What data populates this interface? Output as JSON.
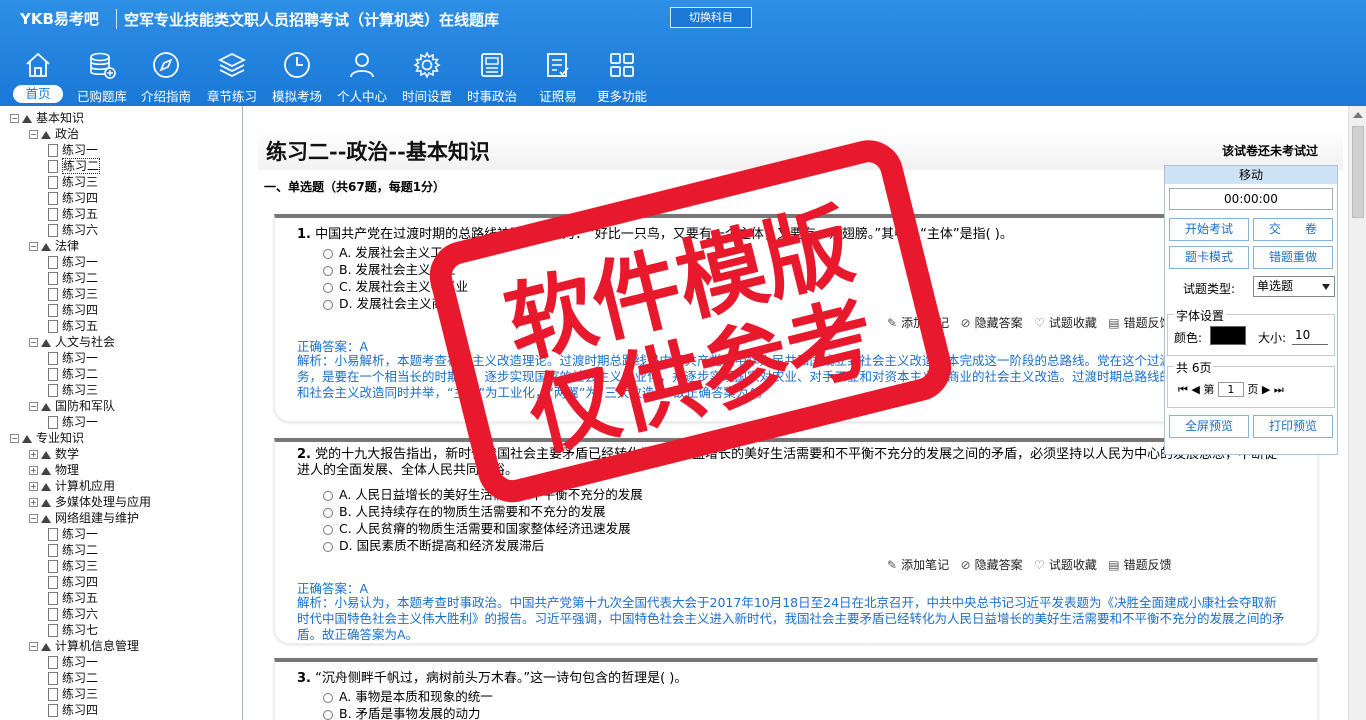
{
  "app": {
    "logo": "YKB易考吧",
    "title": "空军专业技能类文职人员招聘考试（计算机类）在线题库",
    "switch_subject": "切换科目"
  },
  "nav": [
    {
      "label": "首页",
      "icon": "home-icon",
      "active": true
    },
    {
      "label": "已购题库",
      "icon": "database-icon"
    },
    {
      "label": "介绍指南",
      "icon": "compass-icon"
    },
    {
      "label": "章节练习",
      "icon": "layers-icon"
    },
    {
      "label": "模拟考场",
      "icon": "clock-icon"
    },
    {
      "label": "个人中心",
      "icon": "user-icon"
    },
    {
      "label": "时间设置",
      "icon": "gear-icon"
    },
    {
      "label": "时事政治",
      "icon": "newspaper-icon"
    },
    {
      "label": "证照易",
      "icon": "checklist-icon"
    },
    {
      "label": "更多功能",
      "icon": "grid-icon"
    }
  ],
  "tree": [
    {
      "level": 0,
      "kind": "folder",
      "exp": "-",
      "label": "基本知识"
    },
    {
      "level": 1,
      "kind": "folder",
      "exp": "-",
      "label": "政治"
    },
    {
      "level": 2,
      "kind": "doc",
      "label": "练习一"
    },
    {
      "level": 2,
      "kind": "doc",
      "label": "练习二",
      "selected": true
    },
    {
      "level": 2,
      "kind": "doc",
      "label": "练习三"
    },
    {
      "level": 2,
      "kind": "doc",
      "label": "练习四"
    },
    {
      "level": 2,
      "kind": "doc",
      "label": "练习五"
    },
    {
      "level": 2,
      "kind": "doc",
      "label": "练习六"
    },
    {
      "level": 1,
      "kind": "folder",
      "exp": "-",
      "label": "法律"
    },
    {
      "level": 2,
      "kind": "doc",
      "label": "练习一"
    },
    {
      "level": 2,
      "kind": "doc",
      "label": "练习二"
    },
    {
      "level": 2,
      "kind": "doc",
      "label": "练习三"
    },
    {
      "level": 2,
      "kind": "doc",
      "label": "练习四"
    },
    {
      "level": 2,
      "kind": "doc",
      "label": "练习五"
    },
    {
      "level": 1,
      "kind": "folder",
      "exp": "-",
      "label": "人文与社会"
    },
    {
      "level": 2,
      "kind": "doc",
      "label": "练习一"
    },
    {
      "level": 2,
      "kind": "doc",
      "label": "练习二"
    },
    {
      "level": 2,
      "kind": "doc",
      "label": "练习三"
    },
    {
      "level": 1,
      "kind": "folder",
      "exp": "-",
      "label": "国防和军队"
    },
    {
      "level": 2,
      "kind": "doc",
      "label": "练习一"
    },
    {
      "level": 0,
      "kind": "folder",
      "exp": "-",
      "label": "专业知识"
    },
    {
      "level": 1,
      "kind": "folder",
      "exp": "+",
      "label": "数学"
    },
    {
      "level": 1,
      "kind": "folder",
      "exp": "+",
      "label": "物理"
    },
    {
      "level": 1,
      "kind": "folder",
      "exp": "+",
      "label": "计算机应用"
    },
    {
      "level": 1,
      "kind": "folder",
      "exp": "+",
      "label": "多媒体处理与应用"
    },
    {
      "level": 1,
      "kind": "folder",
      "exp": "-",
      "label": "网络组建与维护"
    },
    {
      "level": 2,
      "kind": "doc",
      "label": "练习一"
    },
    {
      "level": 2,
      "kind": "doc",
      "label": "练习二"
    },
    {
      "level": 2,
      "kind": "doc",
      "label": "练习三"
    },
    {
      "level": 2,
      "kind": "doc",
      "label": "练习四"
    },
    {
      "level": 2,
      "kind": "doc",
      "label": "练习五"
    },
    {
      "level": 2,
      "kind": "doc",
      "label": "练习六"
    },
    {
      "level": 2,
      "kind": "doc",
      "label": "练习七"
    },
    {
      "level": 1,
      "kind": "folder",
      "exp": "-",
      "label": "计算机信息管理"
    },
    {
      "level": 2,
      "kind": "doc",
      "label": "练习一"
    },
    {
      "level": 2,
      "kind": "doc",
      "label": "练习二"
    },
    {
      "level": 2,
      "kind": "doc",
      "label": "练习三"
    },
    {
      "level": 2,
      "kind": "doc",
      "label": "练习四"
    }
  ],
  "paper": {
    "title": "练习二--政治--基本知识",
    "status": "该试卷还未考试过",
    "section": "一、单选题（共67题，每题1分）"
  },
  "questions": [
    {
      "num": "1.",
      "text": "中国共产党在过渡时期的总路线被形象描述为：“好比一只鸟，又要有一个主体，又要有一对翅膀。”其中，“主体”是指( )。",
      "options": [
        "A. 发展社会主义工业",
        "B. 发展社会主义农业",
        "C. 发展社会主义手工业",
        "D. 发展社会主义商业"
      ],
      "actions": [
        "添加笔记",
        "隐藏答案",
        "试题收藏",
        "错题反馈"
      ],
      "answer": "正确答案：A",
      "analysis": "解析：小易解析，本题考查社会主义改造理论。过渡时期总路线是中国共产党在中华人民共和国成立到社会主义改造基本完成这一阶段的总路线。党在这个过渡时期的总路线和总任务，是要在一个相当长的时期内，逐步实现国家的社会主义工业化，并逐步实现国家对农业、对手工业和对资本主义工商业的社会主义改造。过渡时期总路线的特点是社会主义建设和社会主义改造同时并举，“主体”为工业化，“两翼”为“三大改造”。故正确答案为A。"
    },
    {
      "num": "2.",
      "text": "党的十九大报告指出，新时代我国社会主要矛盾已经转化为人民日益增长的美好生活需要和不平衡不充分的发展之间的矛盾，必须坚持以人民为中心的发展思想，不断促进人的全面发展、全体人民共同富裕。",
      "options": [
        "A. 人民日益增长的美好生活需要和不平衡不充分的发展",
        "B. 人民持续存在的物质生活需要和不充分的发展",
        "C. 人民贫瘠的物质生活需要和国家整体经济迅速发展",
        "D. 国民素质不断提高和经济发展滞后"
      ],
      "actions": [
        "添加笔记",
        "隐藏答案",
        "试题收藏",
        "错题反馈"
      ],
      "answer": "正确答案：A",
      "analysis": "解析：小易认为，本题考查时事政治。中国共产党第十九次全国代表大会于2017年10月18日至24日在北京召开，中共中央总书记习近平发表题为《决胜全面建成小康社会夺取新时代中国特色社会主义伟大胜利》的报告。习近平强调，中国特色社会主义进入新时代，我国社会主要矛盾已经转化为人民日益增长的美好生活需要和不平衡不充分的发展之间的矛盾。故正确答案为A。"
    },
    {
      "num": "3.",
      "text": "“沉舟侧畔千帆过，病树前头万木春。”这一诗句包含的哲理是( )。",
      "options": [
        "A. 事物是本质和现象的统一",
        "B. 矛盾是事物发展的动力"
      ]
    }
  ],
  "panel": {
    "move": "移动",
    "timer": "00:00:00",
    "start_exam": "开始考试",
    "submit": "交　　卷",
    "card_mode": "题卡模式",
    "wrong_redo": "错题重做",
    "qtype_label": "试题类型:",
    "qtype_value": "单选题",
    "font_group": "字体设置",
    "color_label": "颜色:",
    "color_value": "#000000",
    "size_label": "大小:",
    "size_value": "10",
    "pages_label": "共 6页",
    "page_prefix": "第",
    "page_value": "1",
    "page_suffix": "页",
    "fullscreen": "全屏预览",
    "print": "打印预览"
  },
  "stamp": {
    "line1": "软件模版",
    "line2": "仅供参考",
    "color": "#e8192c"
  }
}
